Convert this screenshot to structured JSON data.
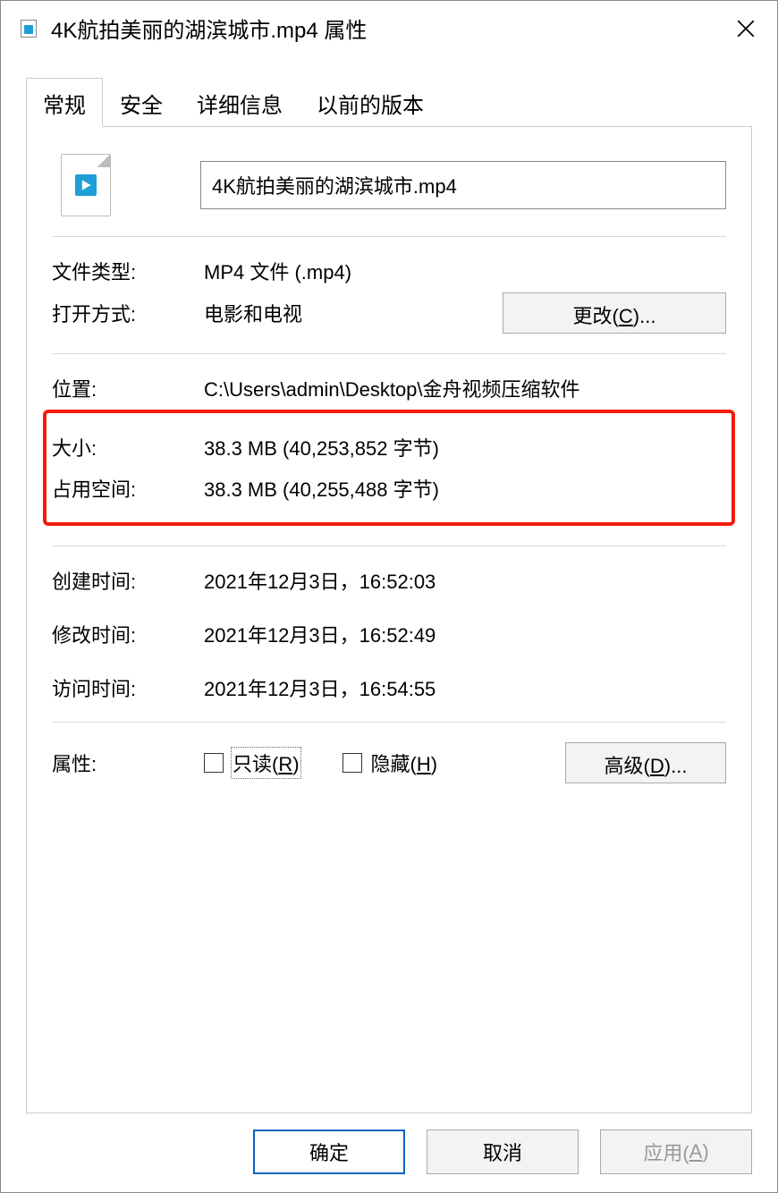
{
  "title": "4K航拍美丽的湖滨城市.mp4 属性",
  "tabs": {
    "general": "常规",
    "security": "安全",
    "details": "详细信息",
    "previous": "以前的版本"
  },
  "filename": "4K航拍美丽的湖滨城市.mp4",
  "labels": {
    "file_type": "文件类型:",
    "opens_with": "打开方式:",
    "location": "位置:",
    "size": "大小:",
    "size_on_disk": "占用空间:",
    "created": "创建时间:",
    "modified": "修改时间:",
    "accessed": "访问时间:",
    "attributes": "属性:"
  },
  "values": {
    "file_type": "MP4 文件 (.mp4)",
    "opens_with": "电影和电视",
    "location": "C:\\Users\\admin\\Desktop\\金舟视频压缩软件",
    "size": "38.3 MB (40,253,852 字节)",
    "size_on_disk": "38.3 MB (40,255,488 字节)",
    "created": "2021年12月3日，16:52:03",
    "modified": "2021年12月3日，16:52:49",
    "accessed": "2021年12月3日，16:54:55"
  },
  "buttons": {
    "change_pre": "更改(",
    "change_key": "C",
    "change_post": ")...",
    "advanced_pre": "高级(",
    "advanced_key": "D",
    "advanced_post": ")...",
    "ok": "确定",
    "cancel": "取消",
    "apply_pre": "应用(",
    "apply_key": "A",
    "apply_post": ")"
  },
  "checkboxes": {
    "readonly_pre": "只读(",
    "readonly_key": "R",
    "readonly_post": ")",
    "hidden_pre": "隐藏(",
    "hidden_key": "H",
    "hidden_post": ")"
  }
}
